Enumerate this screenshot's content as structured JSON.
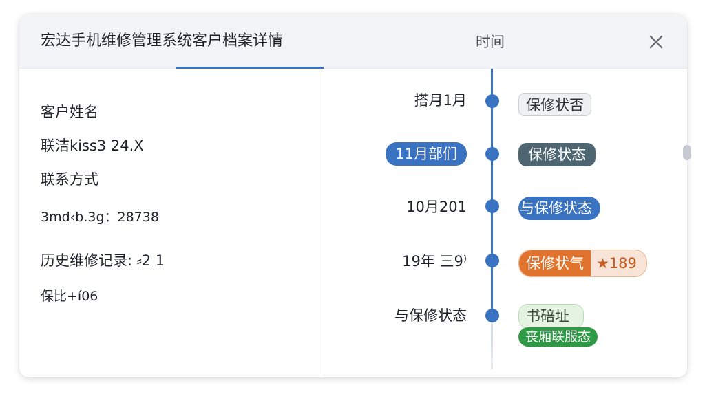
{
  "header": {
    "title": "宏达手机维修管理系统客户档案详情",
    "time_label": "时间"
  },
  "customer": {
    "name_label": "客户姓名",
    "name_value": "联洁kiss3 24.X",
    "contact_label": "联系方式",
    "contact_value": "3md‹b.3g：28738",
    "history_label": "历史维修记录: ⸗2 1",
    "warranty_text": "保比+í06"
  },
  "timeline": {
    "items": [
      {
        "date": "搭月1月",
        "date_style": "plain",
        "tags": [
          {
            "text": "保修状否",
            "style": "gray"
          }
        ]
      },
      {
        "date": "11月部们",
        "date_style": "pill",
        "tags": [
          {
            "text": "保修状态",
            "style": "slate"
          }
        ]
      },
      {
        "date": "10月201",
        "date_style": "plain",
        "tags": [
          {
            "text": "与保修状态",
            "style": "blue"
          }
        ]
      },
      {
        "date": "19年 三9⁾",
        "date_style": "plain",
        "tags": [
          {
            "text": "保修状气",
            "style": "orange"
          },
          {
            "text": "★189",
            "style": "orange-count"
          }
        ]
      },
      {
        "date": "与保修状态",
        "date_style": "plain",
        "tags": [
          {
            "text": "书碚址",
            "style": "green-light"
          },
          {
            "text": "丧厢联服态",
            "style": "green"
          }
        ]
      }
    ]
  },
  "colors": {
    "accent": "#3a73c2",
    "slate": "#4e6672",
    "orange": "#e0742f",
    "green": "#2f9a45"
  }
}
